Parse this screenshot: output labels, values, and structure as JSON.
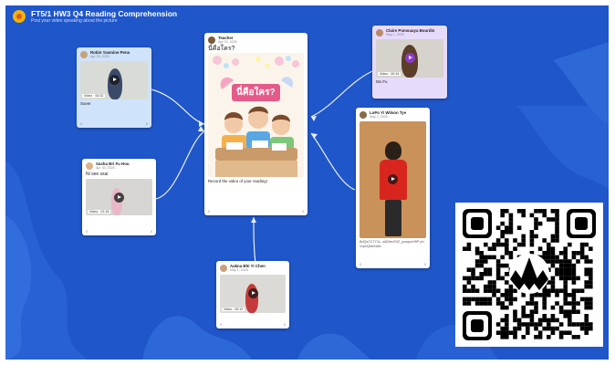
{
  "board": {
    "title": "FT5/1 HW3 Q4 Reading Comprehension",
    "subtitle": "Post your video speaking about the picture"
  },
  "posts": {
    "teacher": {
      "author": "Teacher",
      "date": "Apr 29, 2025",
      "heading": "นี่คือใคร?",
      "image_text": "นี่คือใคร?",
      "caption": "Record the video of your reading!",
      "likes": "0",
      "comments": "0"
    },
    "p1": {
      "author": "Robin Yasmine Pena",
      "date": "Apr 30, 2025",
      "tag": "Video · 00:32",
      "caption": "Sueer",
      "likes": "0",
      "comments": "0"
    },
    "p2": {
      "author": "Sasha Bri Fu Hou",
      "date": "Apr 30, 2025",
      "caption": "Ni see ssai",
      "tag": "Video · 01:18",
      "likes": "0",
      "comments": "0"
    },
    "p3": {
      "author": "Aakna Bhi Yi Chen",
      "date": "May 1, 2025",
      "tag": "Video · 00:19",
      "likes": "0",
      "comments": "0"
    },
    "p4": {
      "author": "Claire Pomsuaya Bourdin",
      "date": "May 1, 2025",
      "tag": "Video · 00:16",
      "caption": "Mo Fu",
      "likes": "0",
      "comments": "0"
    },
    "p5": {
      "author": "LoPo Yi Wilson Tye",
      "date": "May 2, 2025",
      "caption": "BdQs7C7Y1L..a8Zbe4SIZ_ycsqocH5P phVq4rQl6nNaN",
      "likes": "0",
      "comments": "0"
    }
  },
  "colors": {
    "board": "#1f56c9",
    "card_blue": "#cfe3fb",
    "card_purple": "#e7dbfb"
  }
}
